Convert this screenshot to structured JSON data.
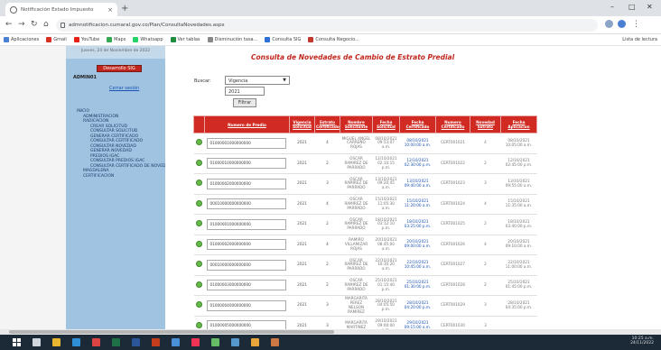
{
  "browser": {
    "tab_title": "Notificación Estado Impuesto",
    "tab_close": "×",
    "new_tab": "+",
    "url": "admnotificacion.cumaral.gov.co/Plan/ConsultaNovedades.aspx",
    "bookmarks": [
      "Aplicaciones",
      "Gmail",
      "YouTube",
      "Maps",
      "Whatsapp",
      "Ver tablas",
      "Disminución tasa...",
      "Consulta SIG",
      "Consulta Negocio..."
    ],
    "bookmarks_right": "Lista de lectura"
  },
  "sidebar": {
    "top_text": "Jueves, 24 de Noviembre de 2022",
    "button_label": "Desarrollo SIG",
    "user": "ADMIN01",
    "close_session": "Cerrar sesión",
    "tree": [
      {
        "label": "INICIO",
        "level": 1
      },
      {
        "label": "ADMINISTRACION",
        "level": 2
      },
      {
        "label": "RADICACION",
        "level": 2
      },
      {
        "label": "CREAR SOLICITUD",
        "level": 3
      },
      {
        "label": "CONSULTAR SOLICITUD",
        "level": 3
      },
      {
        "label": "GENERAR CERTIFICADO",
        "level": 3
      },
      {
        "label": "CONSULTAR CERTIFICADO",
        "level": 3
      },
      {
        "label": "CONSULTAR NOVEDAD",
        "level": 3
      },
      {
        "label": "GENERAR NOVEDAD",
        "level": 3
      },
      {
        "label": "PREDIOS IGAC",
        "level": 3
      },
      {
        "label": "CONSULTAR PREDIOS IGAC",
        "level": 3
      },
      {
        "label": "CONSULTAR CERTIFICADO DE NOVEDAD",
        "level": 3
      },
      {
        "label": "MAGDALENA",
        "level": 2
      },
      {
        "label": "CERTIFICACION",
        "level": 2
      }
    ]
  },
  "main": {
    "title": "Consulta de Novedades de Cambio de Estrato Predial",
    "buscar_label": "Buscar:",
    "select_value": "Vigencia",
    "input_value": "2021",
    "filter_button": "Filtrar",
    "columns": [
      "Numero de Predio",
      "Vigencia Solicitud",
      "Estrato Certificado",
      "Nombre Solicitante",
      "Fecha Solicitud",
      "Fecha Certificado",
      "Numero Certificado",
      "Novedad Estrato",
      "Fecha Aplicacion"
    ],
    "rows": [
      [
        "01000001000000000",
        "2021",
        "4",
        "MIGUEL ANGEL CARREÑO ROJAS",
        "08/10/2021 09:53:07 a.m.",
        "08/10/2021 10:00:00 a.m.",
        "CERT001021",
        "4",
        "08/10/2021 10:05:00 a.m."
      ],
      [
        "01000010000000000",
        "2021",
        "2",
        "OSCAR RAMIREZ DE PARRADO",
        "12/10/2021 02:10:15 p.m.",
        "12/10/2021 02:30:00 p.m.",
        "CERT001022",
        "2",
        "12/10/2021 02:45:00 p.m."
      ],
      [
        "01000002000000000",
        "2021",
        "3",
        "OSCAR RAMIREZ DE PARRADO",
        "13/10/2021 09:20:45 a.m.",
        "13/10/2021 09:40:00 a.m.",
        "CERT001023",
        "3",
        "13/10/2021 09:55:00 a.m."
      ],
      [
        "00010000000000000",
        "2021",
        "4",
        "OSCAR RAMIREZ DE PARRADO",
        "15/10/2021 11:05:30 a.m.",
        "15/10/2021 11:20:00 a.m.",
        "CERT001024",
        "4",
        "15/10/2021 11:35:00 a.m."
      ],
      [
        "01000001000000000",
        "2021",
        "2",
        "OSCAR RAMIREZ DE PARRADO",
        "18/10/2021 03:12:10 p.m.",
        "18/10/2021 03:25:00 p.m.",
        "CERT001025",
        "2",
        "18/10/2021 03:40:00 p.m."
      ],
      [
        "01000002000000000",
        "2021",
        "4",
        "RAMIRO VILLAMIZAR ROJAS",
        "20/10/2021 08:45:00 a.m.",
        "20/10/2021 09:00:00 a.m.",
        "CERT001026",
        "4",
        "20/10/2021 09:10:00 a.m."
      ],
      [
        "00010000000000000",
        "2021",
        "2",
        "OSCAR RAMIREZ DE PARRADO",
        "22/10/2021 10:30:20 a.m.",
        "22/10/2021 10:45:00 a.m.",
        "CERT001027",
        "2",
        "22/10/2021 11:00:00 a.m."
      ],
      [
        "01000003000000000",
        "2021",
        "2",
        "OSCAR RAMIREZ DE PARRADO",
        "25/10/2021 01:15:40 p.m.",
        "25/10/2021 01:30:00 p.m.",
        "CERT001028",
        "2",
        "25/10/2021 01:45:00 p.m."
      ],
      [
        "01000004000000000",
        "2021",
        "3",
        "MARGARITA PEREZ NELSON RAMIREZ",
        "28/10/2021 04:05:50 p.m.",
        "28/10/2021 04:20:00 p.m.",
        "CERT001029",
        "3",
        "28/10/2021 04:35:00 p.m."
      ],
      [
        "01000005000000000",
        "2021",
        "3",
        "MARGARITA MARTINEZ",
        "29/10/2021 09:00:00 a.m.",
        "29/10/2021 09:15:00 a.m.",
        "CERT001030",
        "3",
        ""
      ]
    ]
  },
  "taskbar": {
    "time": "10:25 a.m.",
    "date": "24/11/2022"
  }
}
